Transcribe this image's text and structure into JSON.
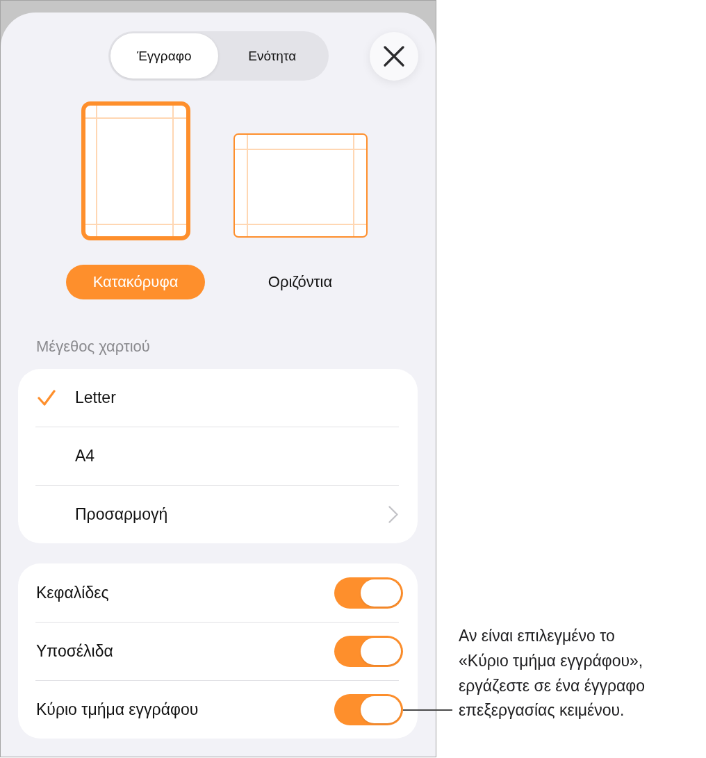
{
  "tabs": [
    {
      "label": "Έγγραφο",
      "selected": true
    },
    {
      "label": "Ενότητα",
      "selected": false
    }
  ],
  "orientations": [
    {
      "kind": "portrait",
      "label": "Κατακόρυφα",
      "selected": true
    },
    {
      "kind": "landscape",
      "label": "Οριζόντια",
      "selected": false
    }
  ],
  "paper_size": {
    "header": "Μέγεθος χαρτιού",
    "options": [
      {
        "kind": "choice",
        "label": "Letter",
        "selected": true
      },
      {
        "kind": "choice",
        "label": "A4",
        "selected": false
      },
      {
        "kind": "disclosure",
        "label": "Προσαρμογή",
        "selected": false
      }
    ]
  },
  "switches": [
    {
      "label": "Κεφαλίδες",
      "on": true
    },
    {
      "label": "Υποσέλιδα",
      "on": true
    },
    {
      "label": "Κύριο τμήμα εγγράφου",
      "on": true
    }
  ],
  "callout": {
    "lines": [
      "Αν είναι επιλεγμένο το",
      "«Κύριο τμήμα εγγράφου»,",
      "εργάζεστε σε ένα έγγραφο",
      "επεξεργασίας κειμένου."
    ]
  }
}
